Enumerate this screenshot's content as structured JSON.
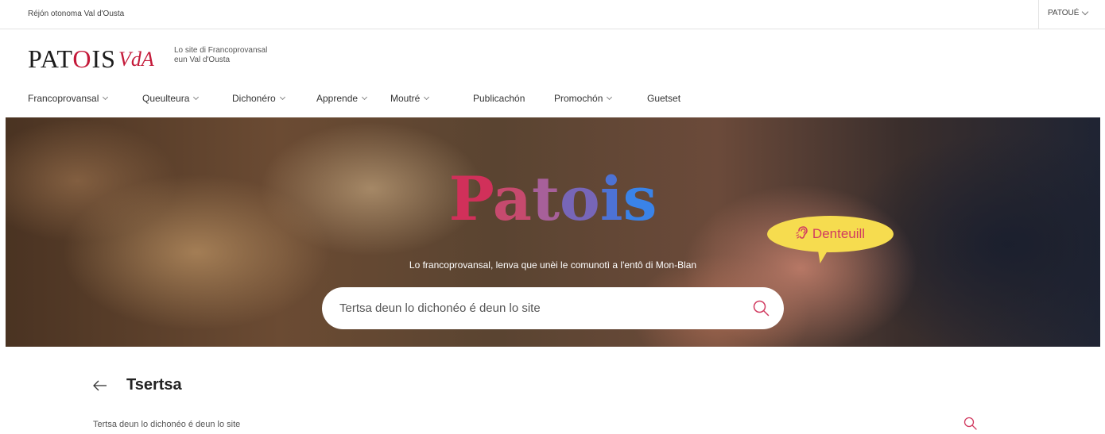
{
  "topbar": {
    "region": "Réjón otonoma Val d'Ousta",
    "language": "PATOUÉ"
  },
  "logo": {
    "main_prefix": "PAT",
    "main_o": "O",
    "main_suffix": "IS",
    "vda": "VdA",
    "tagline_line1": "Lo site di Francoprovansal",
    "tagline_line2": "eun Val d'Ousta"
  },
  "nav": {
    "items": [
      {
        "label": "Francoprovansal",
        "has_dropdown": true
      },
      {
        "label": "Queulteura",
        "has_dropdown": true
      },
      {
        "label": "Dichonéro",
        "has_dropdown": true
      },
      {
        "label": "Apprende",
        "has_dropdown": true
      },
      {
        "label": "Moutré",
        "has_dropdown": true
      },
      {
        "label": "Publicachón",
        "has_dropdown": false
      },
      {
        "label": "Promochón",
        "has_dropdown": true
      },
      {
        "label": "Guetset",
        "has_dropdown": false
      }
    ]
  },
  "hero": {
    "title_letters": [
      "P",
      "a",
      "t",
      "o",
      "i",
      "s"
    ],
    "subtitle": "Lo francoprovansal, lenva que unèi le comunotì a l'entô di Mon-Blan",
    "bubble_label": "Denteuill",
    "bubble_icon": "ear-icon",
    "search_placeholder": "Tertsa deun lo dichonéo é deun lo site",
    "search_icon": "search-icon"
  },
  "content": {
    "back_icon": "arrow-left-icon",
    "title": "Tsertsa",
    "result_text": "Tertsa deun lo dichonéo é deun lo site",
    "result_icon": "search-icon"
  },
  "colors": {
    "accent_red": "#c41a3a",
    "bubble_yellow": "#f6dc4f",
    "bubble_text": "#d13b60"
  }
}
